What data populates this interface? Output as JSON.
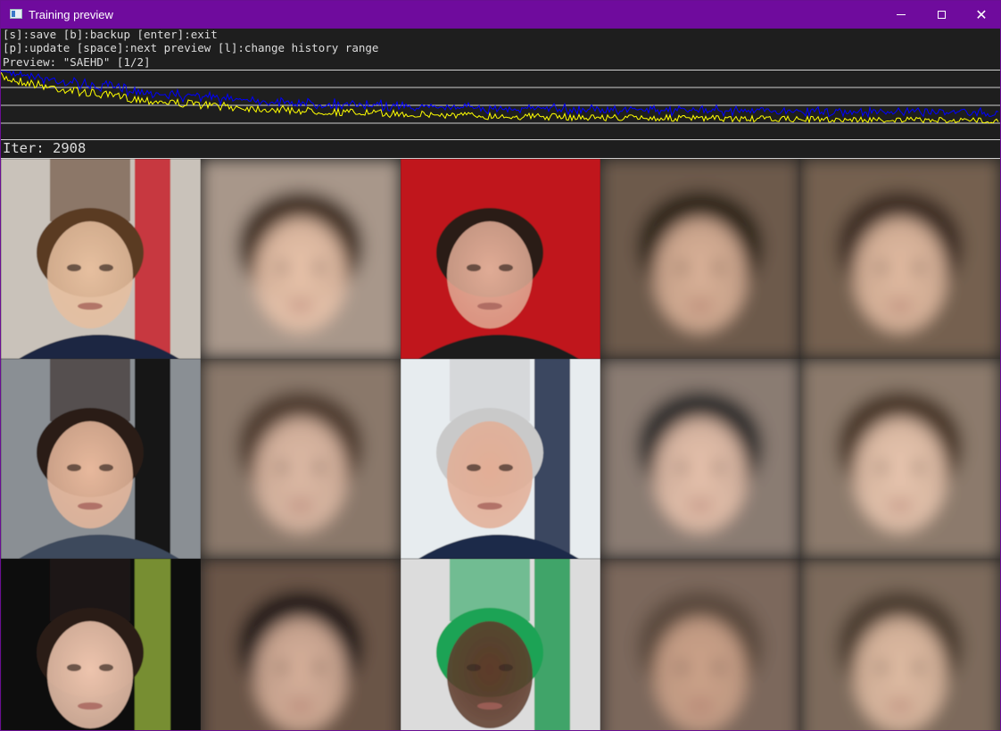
{
  "window": {
    "title": "Training preview",
    "icon": "preview-window-icon",
    "controls": [
      "minimize-icon",
      "maximize-icon",
      "close-icon"
    ],
    "titlebar_color": "#6f0b9d"
  },
  "help_lines": [
    "[s]:save [b]:backup [enter]:exit",
    "[p]:update [space]:next preview [l]:change history range",
    "Preview: \"SAEHD\" [1/2]"
  ],
  "iteration_label": "Iter: 2908",
  "loss_graph": {
    "series_colors": {
      "src_loss": "#ffff00",
      "dst_loss": "#0000ff"
    },
    "background": "#1e1e1e"
  },
  "preview_grid": {
    "columns": 5,
    "rows": 3,
    "tiles": [
      {
        "kind": "source-photo",
        "palette": {
          "bg": "#c9c2ba",
          "face": "#e6bf9f",
          "hair": "#5a3a22",
          "shirt": "#1c2742",
          "accent": "#c7202a"
        }
      },
      {
        "kind": "blurred-reconstruction",
        "palette": {
          "bg": "#a8978a",
          "face": "#eac4ab",
          "hair": "#3f2e24"
        }
      },
      {
        "kind": "source-photo",
        "palette": {
          "bg": "#c0181b",
          "face": "#e0ab95",
          "hair": "#2b1e17",
          "shirt": "#1d1d1f"
        }
      },
      {
        "kind": "blurred-reconstruction",
        "palette": {
          "bg": "#6d5a4b",
          "face": "#dcb399",
          "hair": "#2c2019"
        }
      },
      {
        "kind": "blurred-reconstruction",
        "palette": {
          "bg": "#756050",
          "face": "#e3bca2",
          "hair": "#3a2b22"
        }
      },
      {
        "kind": "source-photo",
        "palette": {
          "bg": "#8a8f94",
          "face": "#e7b89c",
          "hair": "#2a1e18",
          "shirt": "#3d4a5c",
          "accent": "#000000"
        }
      },
      {
        "kind": "blurred-reconstruction",
        "palette": {
          "bg": "#8a786a",
          "face": "#dfbba6",
          "hair": "#4e3b2e"
        }
      },
      {
        "kind": "source-photo",
        "palette": {
          "bg": "#e7ecef",
          "face": "#e2ae96",
          "hair": "#c9c9c9",
          "shirt": "#1e2a4a",
          "accent": "#1b2a48"
        }
      },
      {
        "kind": "blurred-reconstruction",
        "palette": {
          "bg": "#8a7c72",
          "face": "#e9c3ad",
          "hair": "#2a2a2c"
        }
      },
      {
        "kind": "blurred-reconstruction",
        "palette": {
          "bg": "#8c7a6c",
          "face": "#eac7b0",
          "hair": "#463528"
        }
      },
      {
        "kind": "source-photo",
        "palette": {
          "bg": "#0e0e0e",
          "face": "#edc4ad",
          "hair": "#2a1d17",
          "shirt": "#b2b2a2",
          "accent": "#8aa53a"
        }
      },
      {
        "kind": "blurred-reconstruction",
        "palette": {
          "bg": "#6a5547",
          "face": "#d9b29c",
          "hair": "#1f1612"
        }
      },
      {
        "kind": "source-photo",
        "palette": {
          "bg": "#dcdcdc",
          "face": "#5d3a2a",
          "hair": "#1aa355",
          "shirt": "#1d6e3c",
          "accent": "#239a55"
        }
      },
      {
        "kind": "blurred-reconstruction",
        "palette": {
          "bg": "#7b685b",
          "face": "#cda38a",
          "hair": "#5a4a3e"
        }
      },
      {
        "kind": "blurred-reconstruction",
        "palette": {
          "bg": "#7d6a5c",
          "face": "#e1bda4",
          "hair": "#4a3a2e"
        }
      }
    ]
  }
}
